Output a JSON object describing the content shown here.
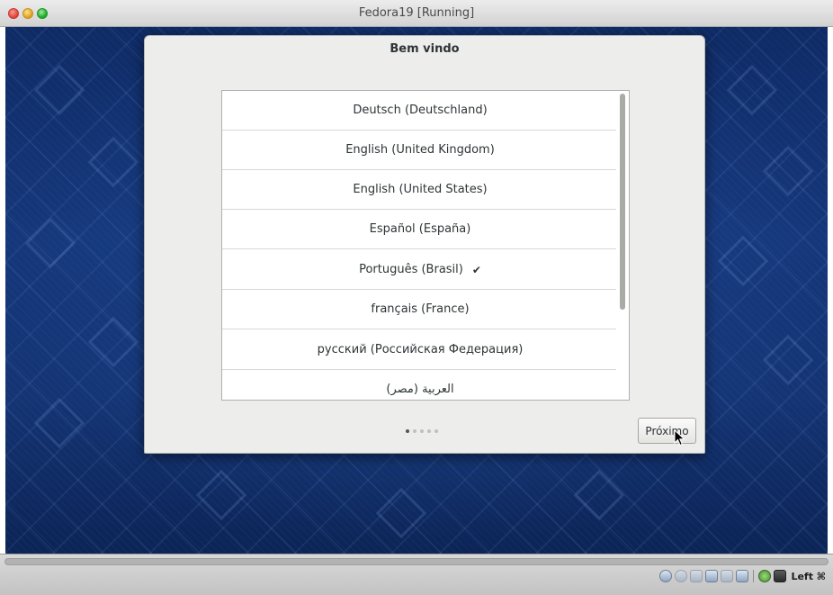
{
  "window": {
    "title": "Fedora19 [Running]"
  },
  "dialog": {
    "title": "Bem vindo",
    "languages": [
      {
        "label": "Deutsch (Deutschland)",
        "selected": false
      },
      {
        "label": "English (United Kingdom)",
        "selected": false
      },
      {
        "label": "English (United States)",
        "selected": false
      },
      {
        "label": "Español (España)",
        "selected": false
      },
      {
        "label": "Português (Brasil)",
        "selected": true
      },
      {
        "label": "français (France)",
        "selected": false
      },
      {
        "label": "русский (Российская Федерация)",
        "selected": false
      },
      {
        "label": "العربية (مصر)",
        "selected": false
      }
    ],
    "check_mark": "✔",
    "pager": {
      "total": 5,
      "current": 1
    },
    "next_label": "Próximo"
  },
  "statusbar": {
    "icons": [
      "disk-icon",
      "optical-drive-icon",
      "usb-icon",
      "network-icon",
      "shared-folder-icon",
      "display-icon",
      "recording-icon",
      "cpu-icon"
    ],
    "host_key": "Left ⌘"
  },
  "colors": {
    "desktop_background": "#15377b",
    "dialog_background": "#ededeb"
  }
}
